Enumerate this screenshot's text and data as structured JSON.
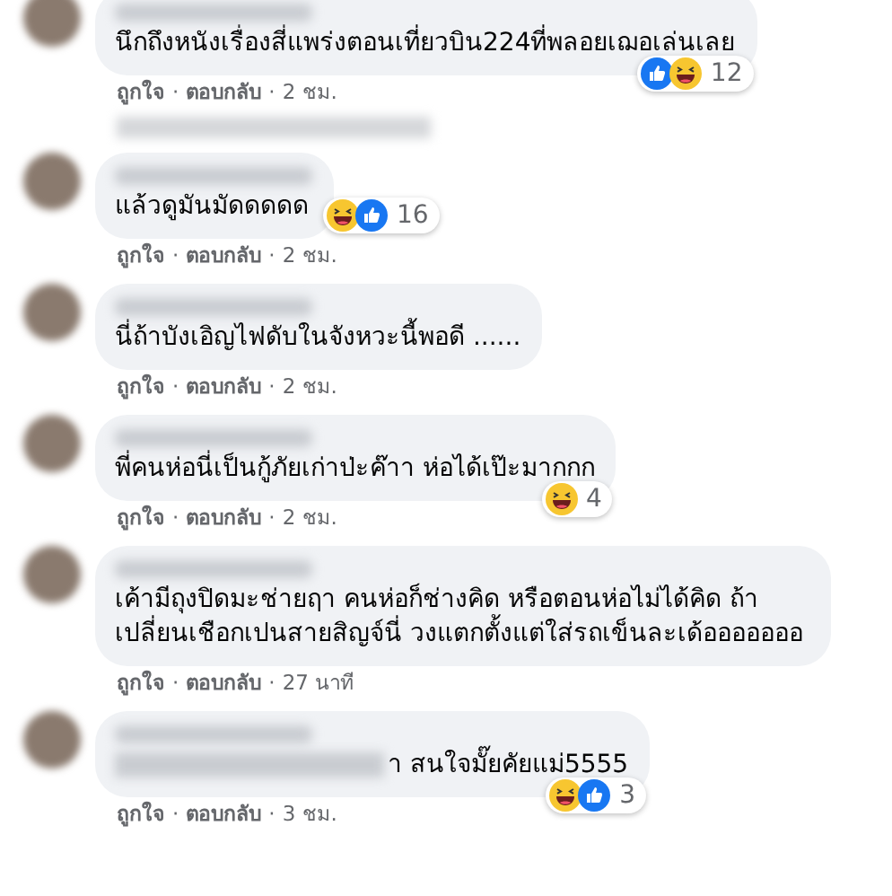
{
  "comments": [
    {
      "text": "นึกถึงหนังเรื่องสี่แพร่งตอนเที่ยวบิน224ที่พลอยเฌอเล่นเลย",
      "text_blurred_prefix": false,
      "reactions": {
        "icons": [
          {
            "kind": "like"
          },
          {
            "kind": "haha"
          }
        ],
        "count": "12"
      },
      "meta": [
        {
          "kind": "link",
          "text": "ถูกใจ"
        },
        {
          "kind": "dot",
          "text": "·"
        },
        {
          "kind": "link",
          "text": "ตอบกลับ"
        },
        {
          "kind": "dot",
          "text": "·"
        },
        {
          "kind": "time",
          "text": "2 ชม."
        }
      ],
      "blurred_reply_line": true
    },
    {
      "text": "แล้วดูมันมัดดดดด",
      "text_blurred_prefix": false,
      "reactions": {
        "icons": [
          {
            "kind": "haha"
          },
          {
            "kind": "like"
          }
        ],
        "count": "16"
      },
      "meta": [
        {
          "kind": "link",
          "text": "ถูกใจ"
        },
        {
          "kind": "dot",
          "text": "·"
        },
        {
          "kind": "link",
          "text": "ตอบกลับ"
        },
        {
          "kind": "dot",
          "text": "·"
        },
        {
          "kind": "time",
          "text": "2 ชม."
        }
      ],
      "blurred_reply_line": false
    },
    {
      "text": "นี่ถ้าบังเอิญไฟดับในจังหวะนี้พอดี ......",
      "text_blurred_prefix": false,
      "meta": [
        {
          "kind": "link",
          "text": "ถูกใจ"
        },
        {
          "kind": "dot",
          "text": "·"
        },
        {
          "kind": "link",
          "text": "ตอบกลับ"
        },
        {
          "kind": "dot",
          "text": "·"
        },
        {
          "kind": "time",
          "text": "2 ชม."
        }
      ],
      "blurred_reply_line": false
    },
    {
      "text": "พี่คนห่อนี่เป็นกู้ภัยเก่าป่ะค๊าา ห่อได้เป๊ะมากกก",
      "text_blurred_prefix": false,
      "reactions": {
        "icons": [
          {
            "kind": "haha"
          }
        ],
        "count": "4"
      },
      "meta": [
        {
          "kind": "link",
          "text": "ถูกใจ"
        },
        {
          "kind": "dot",
          "text": "·"
        },
        {
          "kind": "link",
          "text": "ตอบกลับ"
        },
        {
          "kind": "dot",
          "text": "·"
        },
        {
          "kind": "time",
          "text": "2 ชม."
        }
      ],
      "blurred_reply_line": false
    },
    {
      "text": "เค้ามีถุงปิดมะช่ายฤา คนห่อก็ช่างคิด หรือตอนห่อไม่ได้คิด ถ้าเปลี่ยนเชือกเปนสายสิญจ์นี่ วงแตกตั้งแต่ใส่รถเข็นละเด้อออออออ",
      "text_blurred_prefix": false,
      "meta": [
        {
          "kind": "link",
          "text": "ถูกใจ"
        },
        {
          "kind": "dot",
          "text": "·"
        },
        {
          "kind": "link",
          "text": "ตอบกลับ"
        },
        {
          "kind": "dot",
          "text": "·"
        },
        {
          "kind": "time",
          "text": "27 นาที"
        }
      ],
      "blurred_reply_line": false
    },
    {
      "text": "า สนใจมั๊ยคัยแม่5555",
      "text_blurred_prefix": true,
      "reactions": {
        "icons": [
          {
            "kind": "haha"
          },
          {
            "kind": "like"
          }
        ],
        "count": "3"
      },
      "meta": [
        {
          "kind": "link",
          "text": "ถูกใจ"
        },
        {
          "kind": "dot",
          "text": "·"
        },
        {
          "kind": "link",
          "text": "ตอบกลับ"
        },
        {
          "kind": "dot",
          "text": "·"
        },
        {
          "kind": "time",
          "text": "3 ชม."
        }
      ],
      "blurred_reply_line": false
    }
  ]
}
